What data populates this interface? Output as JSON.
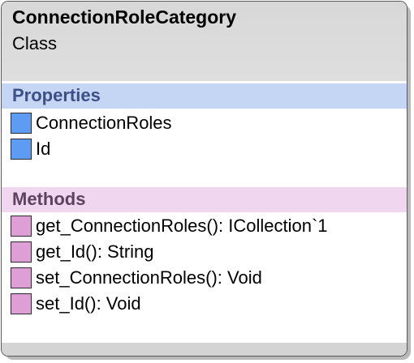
{
  "class": {
    "name": "ConnectionRoleCategory",
    "kind": "Class"
  },
  "properties": {
    "title": "Properties",
    "items": [
      {
        "label": "ConnectionRoles",
        "icon": "property-icon"
      },
      {
        "label": "Id",
        "icon": "property-icon"
      }
    ]
  },
  "methods": {
    "title": "Methods",
    "items": [
      {
        "label": "get_ConnectionRoles(): ICollection`1",
        "icon": "method-icon"
      },
      {
        "label": "get_Id(): String",
        "icon": "method-icon"
      },
      {
        "label": "set_ConnectionRoles(): Void",
        "icon": "method-icon"
      },
      {
        "label": "set_Id(): Void",
        "icon": "method-icon"
      }
    ]
  },
  "colors": {
    "header": "#d8d8d8",
    "properties_band": "#c5d6f4",
    "methods_band": "#f0d6ee",
    "property_icon": "#5e9bf3",
    "method_icon": "#dd9fd5"
  }
}
